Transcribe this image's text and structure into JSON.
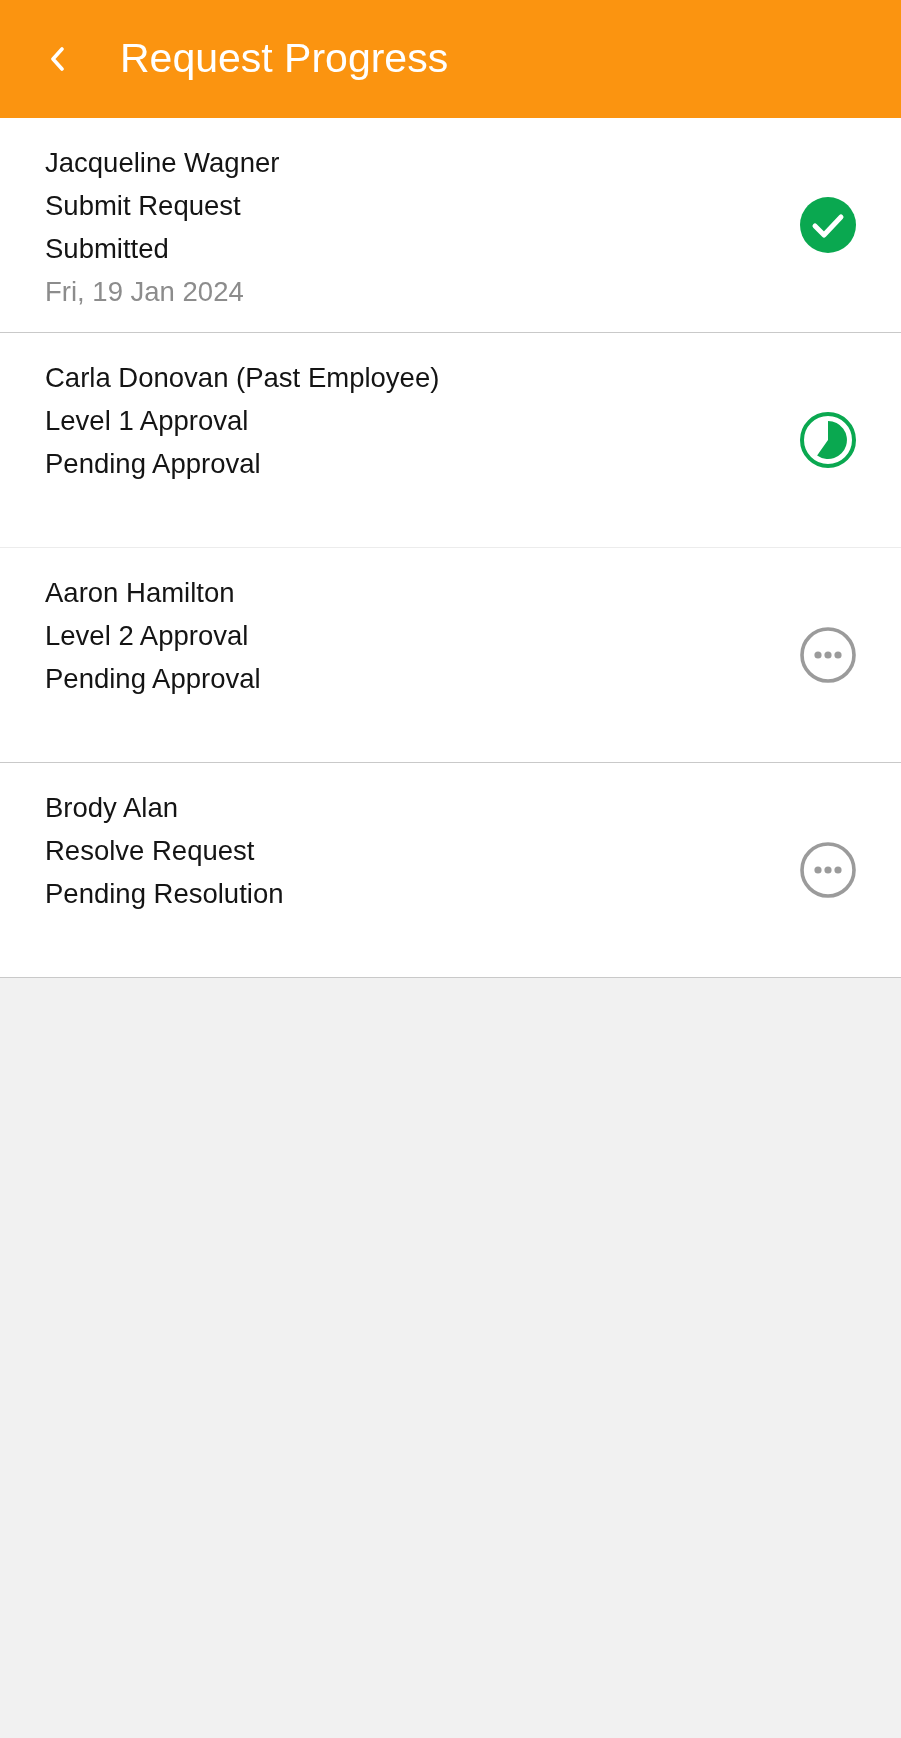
{
  "header": {
    "title": "Request Progress"
  },
  "steps": [
    {
      "name": "Jacqueline Wagner",
      "step": "Submit Request",
      "status": "Submitted",
      "date": "Fri, 19 Jan 2024",
      "kind": "done"
    },
    {
      "name": "Carla Donovan (Past Employee)",
      "step": "Level 1 Approval",
      "status": "Pending Approval",
      "kind": "current"
    },
    {
      "name": "Aaron Hamilton",
      "step": "Level 2 Approval",
      "status": "Pending Approval",
      "kind": "waiting"
    },
    {
      "name": "Brody Alan",
      "step": "Resolve Request",
      "status": "Pending Resolution",
      "kind": "waiting"
    }
  ]
}
